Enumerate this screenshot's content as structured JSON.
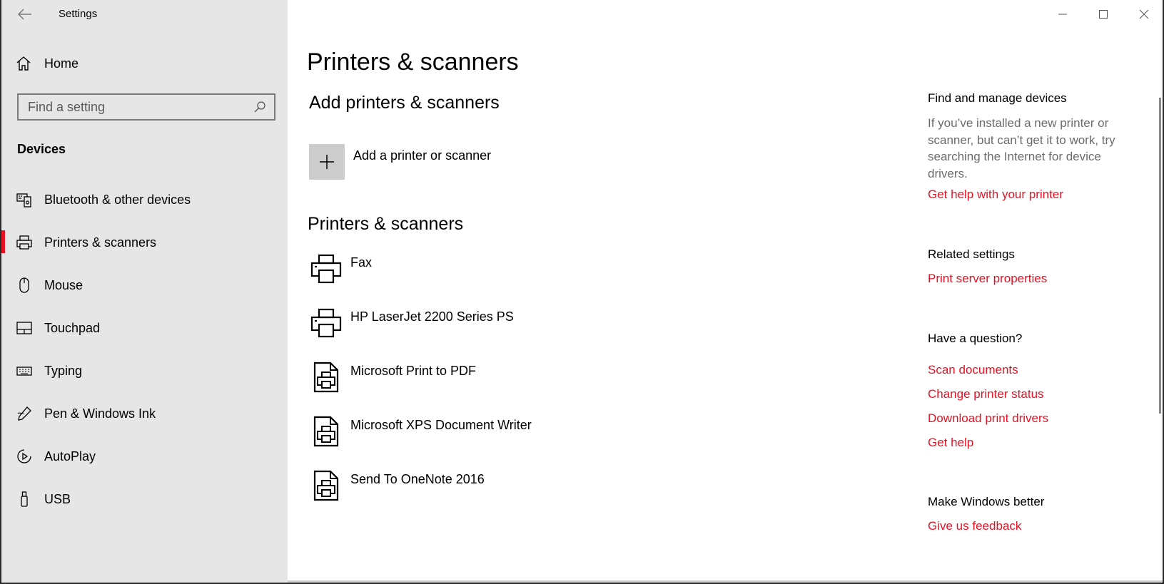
{
  "app_title": "Settings",
  "home_label": "Home",
  "search": {
    "placeholder": "Find a setting"
  },
  "category": "Devices",
  "nav": {
    "items": [
      {
        "label": "Bluetooth & other devices",
        "icon": "bluetooth-devices-icon"
      },
      {
        "label": "Printers & scanners",
        "icon": "printer-icon",
        "selected": true
      },
      {
        "label": "Mouse",
        "icon": "mouse-icon"
      },
      {
        "label": "Touchpad",
        "icon": "touchpad-icon"
      },
      {
        "label": "Typing",
        "icon": "keyboard-icon"
      },
      {
        "label": "Pen & Windows Ink",
        "icon": "pen-icon"
      },
      {
        "label": "AutoPlay",
        "icon": "autoplay-icon"
      },
      {
        "label": "USB",
        "icon": "usb-icon"
      }
    ]
  },
  "main": {
    "title": "Printers & scanners",
    "add_section_title": "Add printers & scanners",
    "add_button_label": "Add a printer or scanner",
    "list_section_title": "Printers & scanners",
    "printers": [
      {
        "name": "Fax",
        "icon": "printer-icon"
      },
      {
        "name": "HP LaserJet 2200 Series PS",
        "icon": "printer-icon"
      },
      {
        "name": "Microsoft Print to PDF",
        "icon": "document-printer-icon"
      },
      {
        "name": "Microsoft XPS Document Writer",
        "icon": "document-printer-icon"
      },
      {
        "name": "Send To OneNote 2016",
        "icon": "document-printer-icon"
      }
    ]
  },
  "right_panel": {
    "find_title": "Find and manage devices",
    "find_desc": "If you’ve installed a new printer or scanner, but can’t get it to work, try searching the Internet for device drivers.",
    "find_link": "Get help with your printer",
    "related_title": "Related settings",
    "related_link": "Print server properties",
    "question_title": "Have a question?",
    "question_links": [
      "Scan documents",
      "Change printer status",
      "Download print drivers",
      "Get help"
    ],
    "better_title": "Make Windows better",
    "better_link": "Give us feedback"
  },
  "colors": {
    "accent": "#e81123",
    "sidebar_bg": "#e6e6e6",
    "muted_text": "#6b6b6b"
  }
}
